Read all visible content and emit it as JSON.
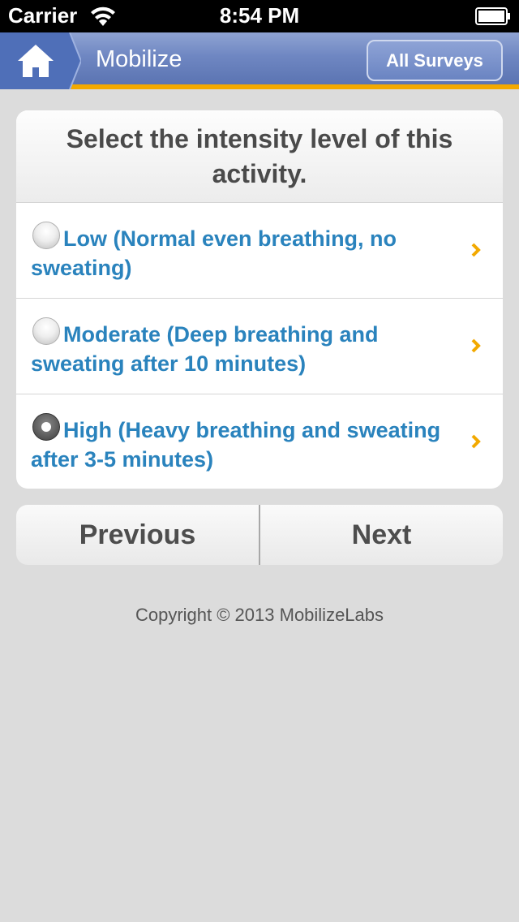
{
  "status_bar": {
    "carrier": "Carrier",
    "time": "8:54 PM"
  },
  "nav": {
    "title": "Mobilize",
    "all_surveys_label": "All Surveys",
    "home_icon": "home-icon"
  },
  "question": "Select the intensity level of this activity.",
  "options": [
    {
      "label": "Low (Normal even breathing, no sweating)",
      "selected": false
    },
    {
      "label": "Moderate (Deep breathing and sweating after 10 minutes)",
      "selected": false
    },
    {
      "label": "High (Heavy breathing and sweating after 3-5 minutes)",
      "selected": true
    }
  ],
  "pager": {
    "previous_label": "Previous",
    "next_label": "Next"
  },
  "footer": {
    "copyright": "Copyright © 2013 MobilizeLabs"
  },
  "colors": {
    "accent_bar": "#f2a900",
    "option_text": "#2a83bd",
    "chevron": "#f2a900"
  }
}
